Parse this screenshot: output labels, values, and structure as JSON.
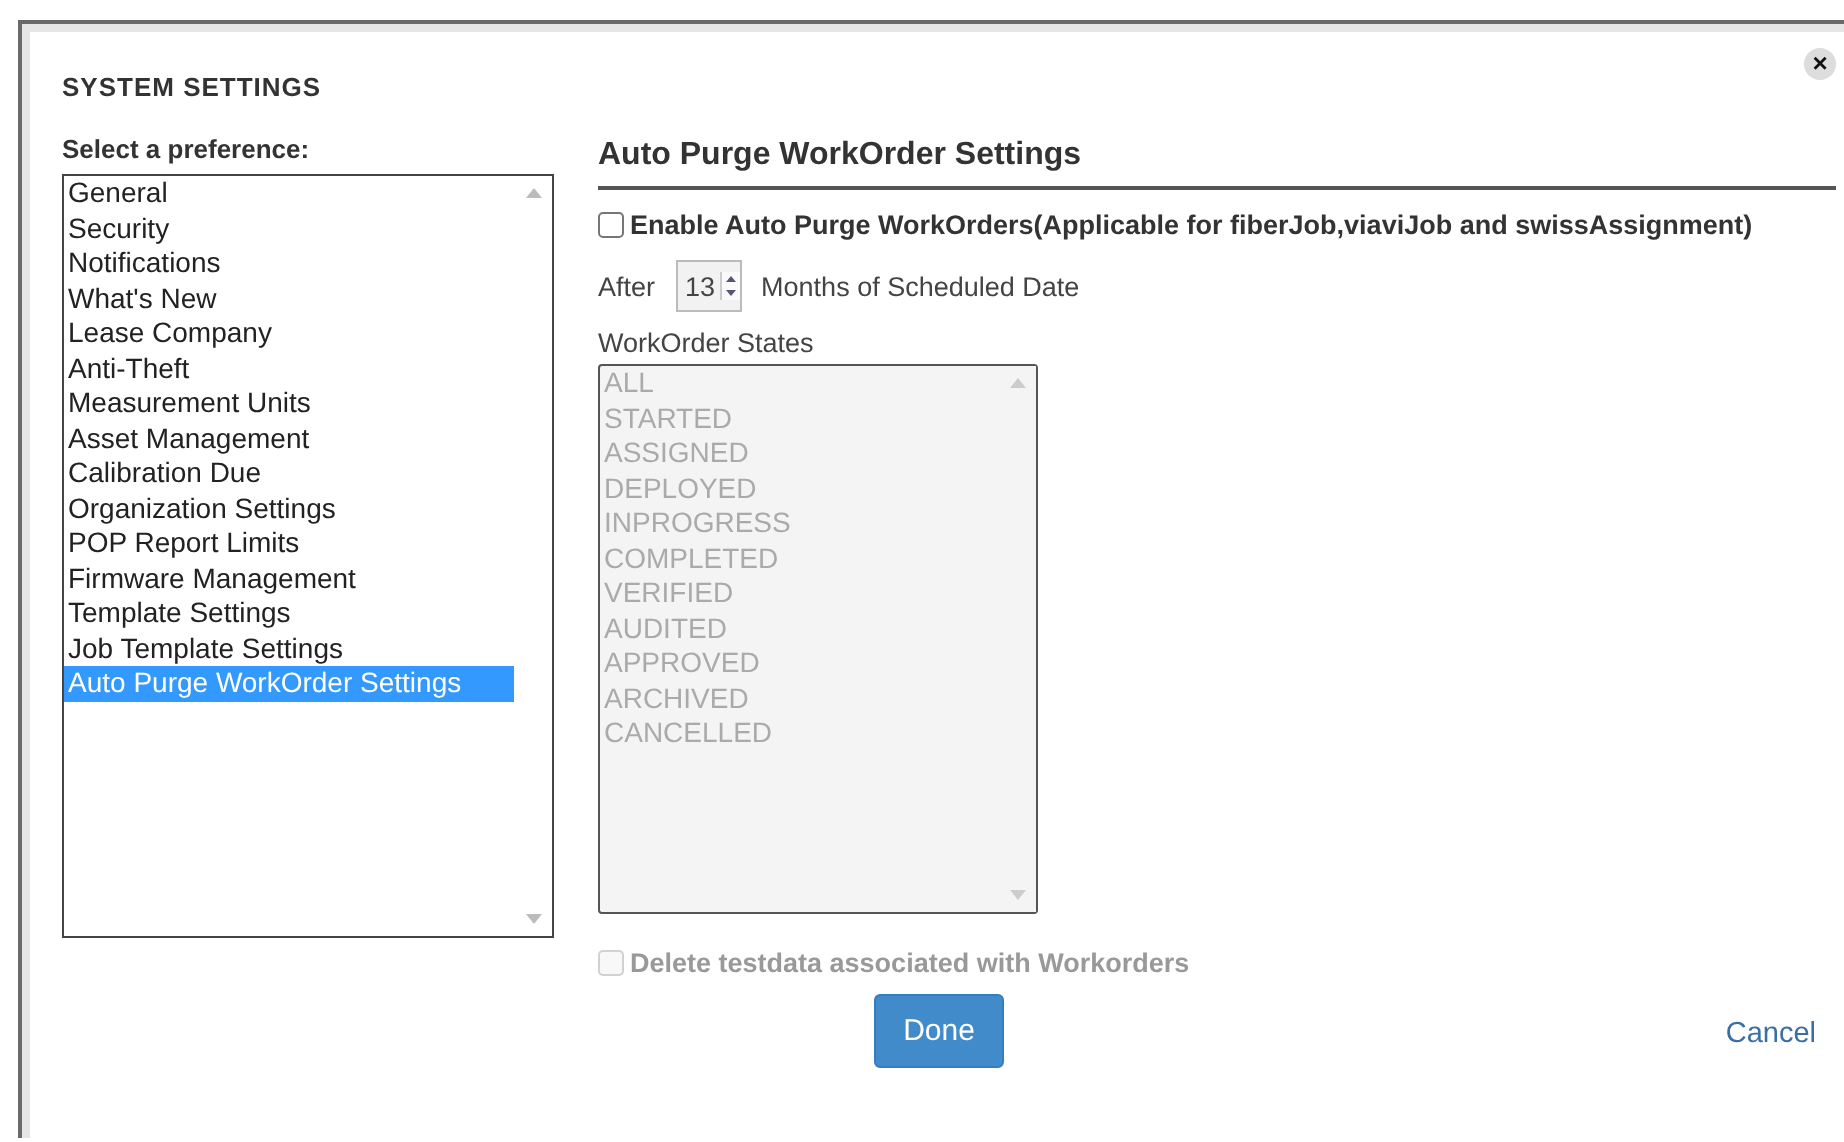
{
  "dialog": {
    "title": "SYSTEM SETTINGS",
    "close_label": "×"
  },
  "preferences": {
    "label": "Select a preference:",
    "items": [
      {
        "label": "General",
        "selected": false
      },
      {
        "label": "Security",
        "selected": false
      },
      {
        "label": "Notifications",
        "selected": false
      },
      {
        "label": "What's New",
        "selected": false
      },
      {
        "label": "Lease Company",
        "selected": false
      },
      {
        "label": "Anti-Theft",
        "selected": false
      },
      {
        "label": "Measurement Units",
        "selected": false
      },
      {
        "label": "Asset Management",
        "selected": false
      },
      {
        "label": "Calibration Due",
        "selected": false
      },
      {
        "label": "Organization Settings",
        "selected": false
      },
      {
        "label": "POP Report Limits",
        "selected": false
      },
      {
        "label": "Firmware Management",
        "selected": false
      },
      {
        "label": "Template Settings",
        "selected": false
      },
      {
        "label": "Job Template Settings",
        "selected": false
      },
      {
        "label": "Auto Purge WorkOrder Settings",
        "selected": true
      }
    ]
  },
  "panel": {
    "heading": "Auto Purge WorkOrder Settings",
    "enable": {
      "label": "Enable Auto Purge WorkOrders(Applicable for fiberJob,viaviJob and swissAssignment)",
      "checked": false,
      "disabled": false
    },
    "after_label": "After",
    "months": {
      "value": "13"
    },
    "months_label": "Months of Scheduled Date",
    "states": {
      "label": "WorkOrder States",
      "disabled": true,
      "items": [
        {
          "label": "ALL",
          "selected": false
        },
        {
          "label": "STARTED",
          "selected": false
        },
        {
          "label": "ASSIGNED",
          "selected": false
        },
        {
          "label": "DEPLOYED",
          "selected": false
        },
        {
          "label": "INPROGRESS",
          "selected": false
        },
        {
          "label": "COMPLETED",
          "selected": false
        },
        {
          "label": "VERIFIED",
          "selected": false
        },
        {
          "label": "AUDITED",
          "selected": false
        },
        {
          "label": "APPROVED",
          "selected": false
        },
        {
          "label": "ARCHIVED",
          "selected": false
        },
        {
          "label": "CANCELLED",
          "selected": false
        }
      ]
    },
    "delete": {
      "label": "Delete testdata associated with Workorders",
      "checked": false,
      "disabled": true
    }
  },
  "buttons": {
    "done": "Done",
    "cancel": "Cancel"
  }
}
